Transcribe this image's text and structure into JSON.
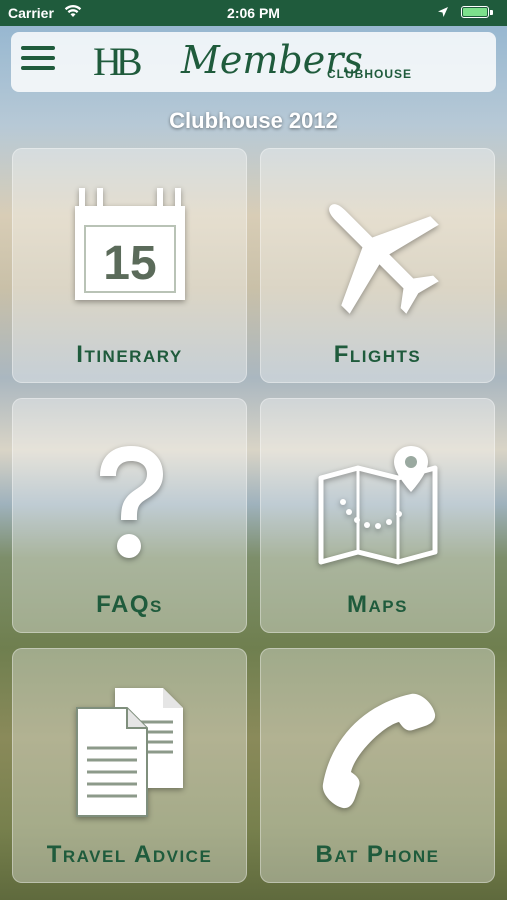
{
  "status_bar": {
    "carrier": "Carrier",
    "time": "2:06 PM",
    "battery_level": 1.0,
    "icons": [
      "wifi-icon",
      "location-arrow-icon",
      "battery-icon"
    ]
  },
  "header": {
    "logo_monogram": "HB",
    "logo_script": "Members",
    "logo_sub": "CLUBHOUSE",
    "menu_icon": "hamburger-menu-icon"
  },
  "page": {
    "title": "Clubhouse 2012"
  },
  "tiles": [
    {
      "label": "Itinerary",
      "icon": "calendar-icon",
      "calendar_day": "15"
    },
    {
      "label": "Flights",
      "icon": "airplane-icon"
    },
    {
      "label": "FAQs",
      "icon": "question-mark-icon"
    },
    {
      "label": "Maps",
      "icon": "map-pin-icon"
    },
    {
      "label": "Travel Advice",
      "icon": "documents-icon"
    },
    {
      "label": "Bat Phone",
      "icon": "phone-icon"
    }
  ],
  "colors": {
    "brand_green": "#1f5b3c",
    "status_bar_bg": "#1f5b3c",
    "battery_fill": "#7ce08b",
    "icon_white": "#ffffff"
  }
}
